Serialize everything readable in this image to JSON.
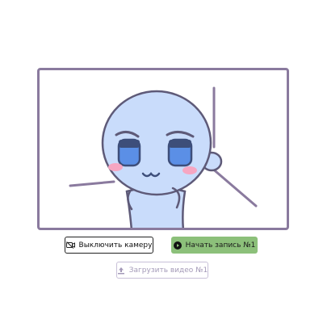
{
  "video": {
    "preview_label": "camera-preview"
  },
  "controls": {
    "camera_button_label": "Выключить камеру",
    "camera_button_icon": "camera-off-icon",
    "record_button_label": "Начать запись №1",
    "record_button_icon": "record-icon",
    "upload_button_label": "Загрузить видео №1",
    "upload_button_icon": "upload-icon",
    "upload_enabled": false
  },
  "colors": {
    "frame_border": "#8a7a9e",
    "record_button_bg": "#8cc07a",
    "upload_disabled_text": "#a49ab8",
    "character_skin": "#c9dcfb",
    "character_eyes": "#5b8fe6",
    "character_cheeks": "#f6a6c2"
  }
}
